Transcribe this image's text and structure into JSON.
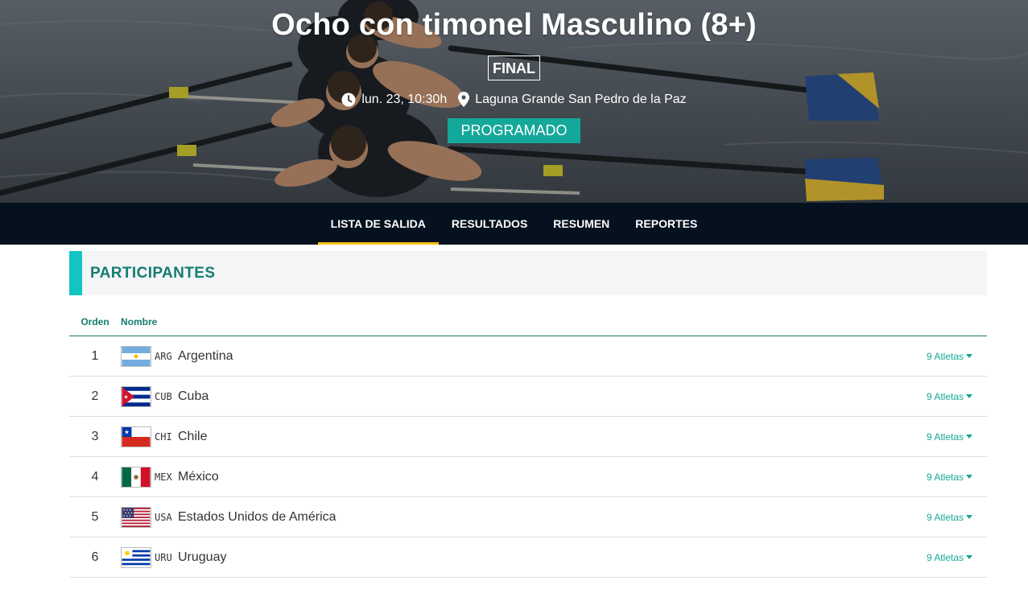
{
  "event": {
    "title": "Ocho con timonel Masculino (8+)",
    "phase": "FINAL",
    "datetime": "lun. 23, 10:30h",
    "venue": "Laguna Grande San Pedro de la Paz",
    "status": "PROGRAMADO",
    "icons": {
      "time": "clock-icon",
      "venue": "location-pin-icon"
    }
  },
  "nav": {
    "tabs": [
      {
        "label": "LISTA DE SALIDA",
        "active": true
      },
      {
        "label": "RESULTADOS",
        "active": false
      },
      {
        "label": "RESUMEN",
        "active": false
      },
      {
        "label": "REPORTES",
        "active": false
      }
    ]
  },
  "participants": {
    "heading": "PARTICIPANTES",
    "columns": {
      "order": "Orden",
      "name": "Nombre"
    },
    "rows": [
      {
        "order": "1",
        "code": "ARG",
        "name": "Argentina",
        "athletes": "9 Atletas"
      },
      {
        "order": "2",
        "code": "CUB",
        "name": "Cuba",
        "athletes": "9 Atletas"
      },
      {
        "order": "3",
        "code": "CHI",
        "name": "Chile",
        "athletes": "9 Atletas"
      },
      {
        "order": "4",
        "code": "MEX",
        "name": "México",
        "athletes": "9 Atletas"
      },
      {
        "order": "5",
        "code": "USA",
        "name": "Estados Unidos de América",
        "athletes": "9 Atletas"
      },
      {
        "order": "6",
        "code": "URU",
        "name": "Uruguay",
        "athletes": "9 Atletas"
      }
    ]
  },
  "colors": {
    "accent_teal": "#14a89a",
    "heading_teal": "#147d70",
    "nav_bg": "#05111f",
    "active_tab_underline": "#f4c20d",
    "section_bar": "#13c5c2"
  }
}
